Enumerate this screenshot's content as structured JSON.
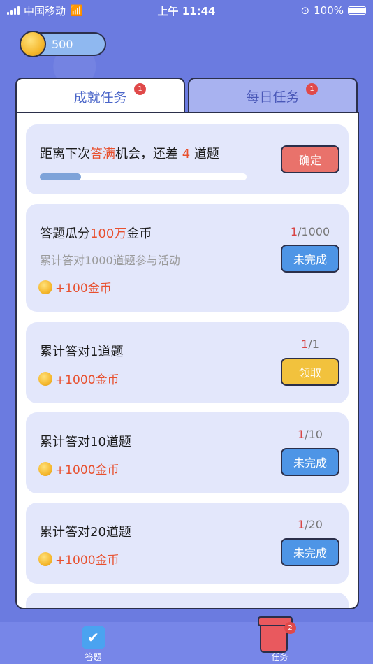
{
  "status_bar": {
    "carrier": "中国移动",
    "time": "上午 11:44",
    "battery": "100%"
  },
  "wallet": {
    "coins": "500"
  },
  "tabs": [
    {
      "label": "成就任务",
      "badge": "1",
      "active": true
    },
    {
      "label": "每日任务",
      "badge": "1",
      "active": false
    }
  ],
  "chance_card": {
    "prefix": "距离下次",
    "highlight": "答满",
    "middle": "机会，还差",
    "remaining": "4",
    "suffix": "道题",
    "progress": 0.2,
    "button": "确定"
  },
  "tasks": [
    {
      "title_prefix": "答题瓜分",
      "title_highlight": "100万",
      "title_suffix": "金币",
      "count_done": "1",
      "count_total": "/1000",
      "desc": "累计答对1000道题参与活动",
      "reward": "+100金币",
      "button": "未完成"
    },
    {
      "title_prefix": "累计答对1道题",
      "count_done": "1",
      "count_total": "/1",
      "reward": "+1000金币",
      "button": "领取"
    },
    {
      "title_prefix": "累计答对10道题",
      "count_done": "1",
      "count_total": "/10",
      "reward": "+1000金币",
      "button": "未完成"
    },
    {
      "title_prefix": "累计答对20道题",
      "count_done": "1",
      "count_total": "/20",
      "reward": "+1000金币",
      "button": "未完成"
    }
  ],
  "bottom_nav": [
    {
      "label": "答题",
      "icon": "check-icon"
    },
    {
      "label": "任务",
      "icon": "task-list-icon",
      "badge": "2"
    }
  ]
}
